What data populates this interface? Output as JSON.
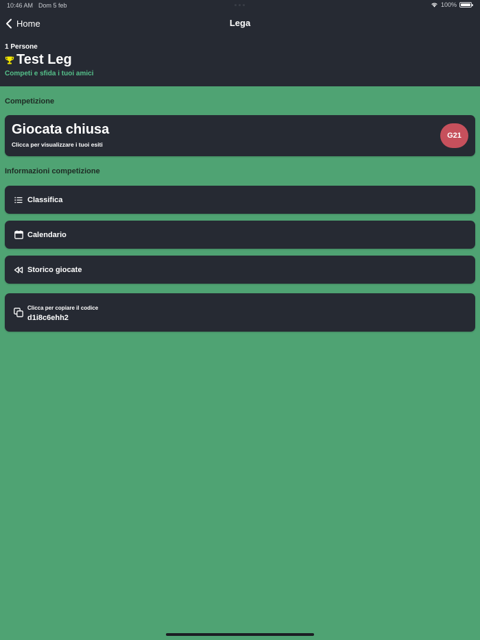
{
  "status_bar": {
    "time": "10:46 AM",
    "date": "Dom 5 feb",
    "battery": "100%"
  },
  "nav": {
    "back_label": "Home",
    "title": "Lega"
  },
  "league": {
    "persons": "1 Persone",
    "name": "Test Leg",
    "tagline": "Competi e sfida i tuoi amici"
  },
  "sections": {
    "competition": "Competizione",
    "info": "Informazioni competizione"
  },
  "competition_card": {
    "title": "Giocata chiusa",
    "subtitle": "Clicca per visualizzare i tuoi esiti",
    "badge": "G21"
  },
  "menu": [
    {
      "label": "Classifica",
      "icon": "list-icon"
    },
    {
      "label": "Calendario",
      "icon": "calendar-icon"
    },
    {
      "label": "Storico giocate",
      "icon": "rewind-icon"
    }
  ],
  "code_card": {
    "hint": "Clicca per copiare il codice",
    "code": "d1i8c6ehh2",
    "icon": "copy-icon"
  },
  "colors": {
    "background": "#4fa373",
    "surface": "#262a33",
    "accent": "#55c08a",
    "badge": "#c6505c",
    "trophy": "#f2e600"
  }
}
